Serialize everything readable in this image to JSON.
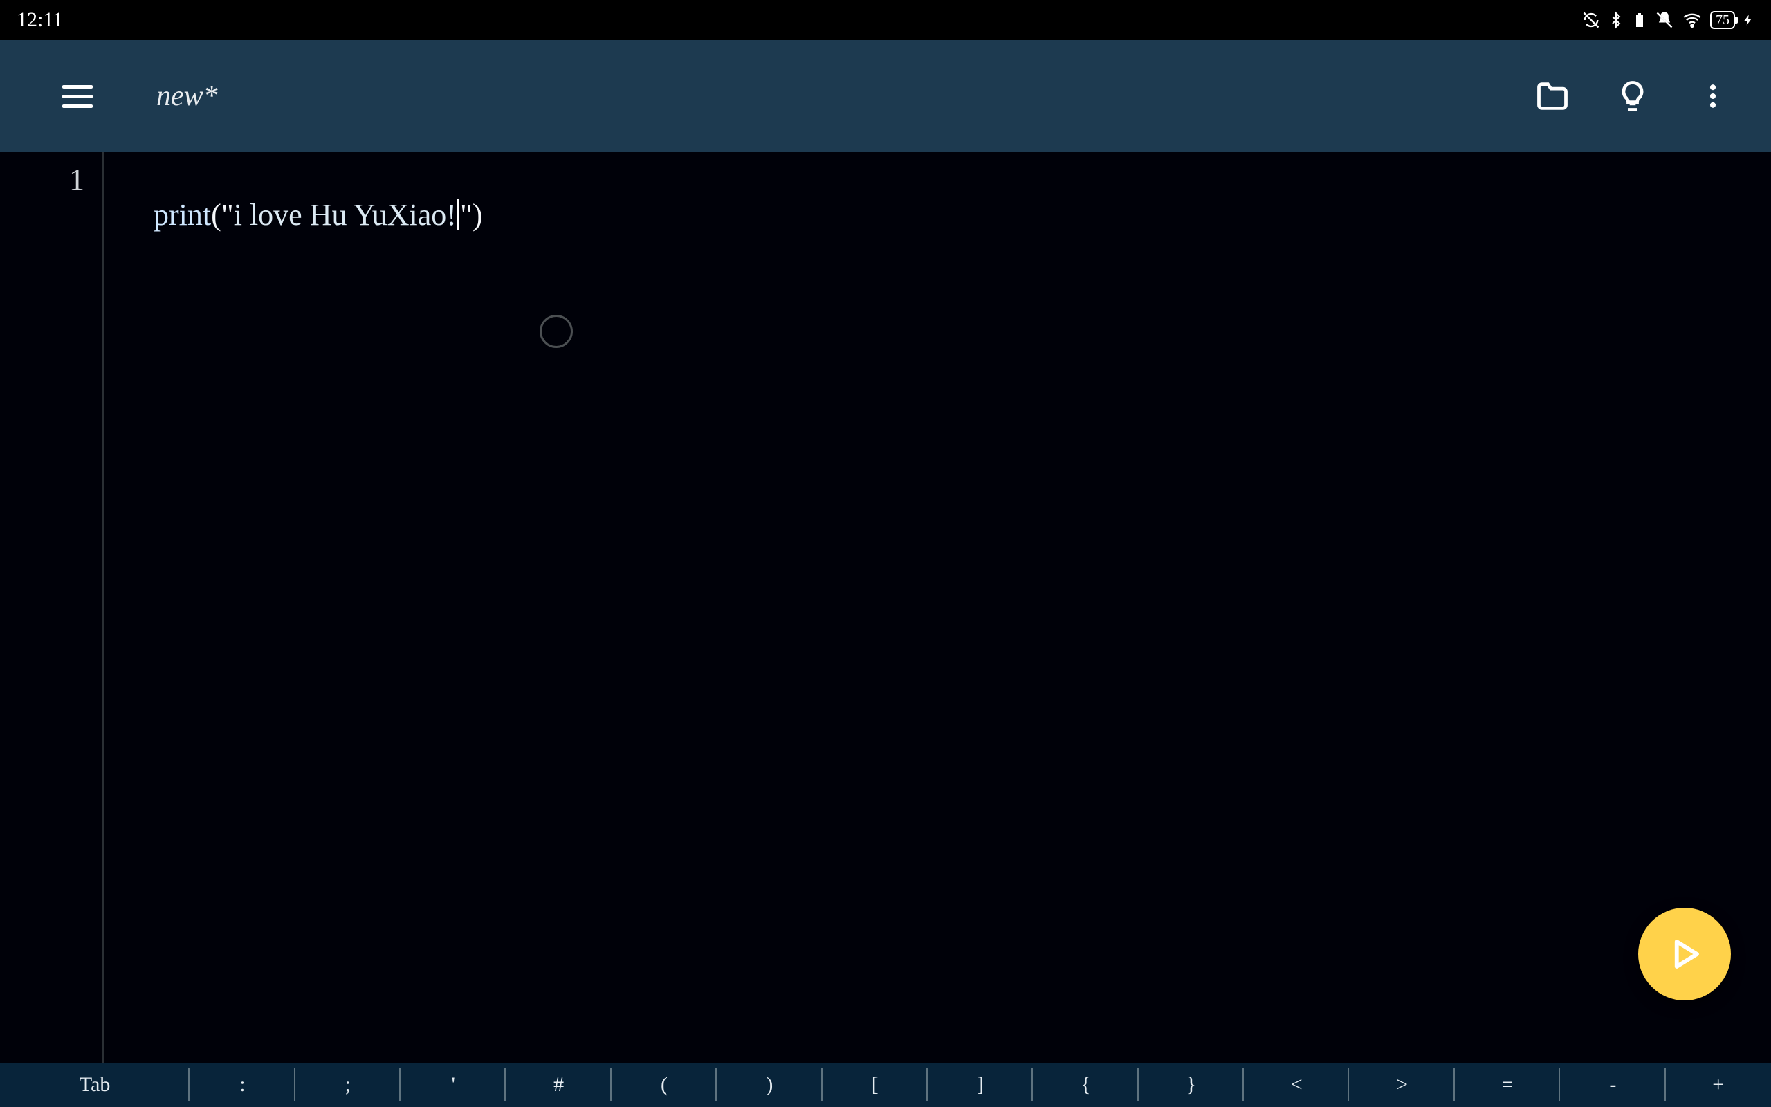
{
  "status": {
    "time": "12:11",
    "battery_text": "75"
  },
  "appbar": {
    "title": "new*"
  },
  "editor": {
    "lines": [
      {
        "num": "1",
        "fn": "print",
        "open": "(\"",
        "str": "i love Hu YuXiao!",
        "close": "\")"
      }
    ]
  },
  "keyrow": {
    "keys": [
      "Tab",
      ":",
      ";",
      "'",
      "#",
      "(",
      ")",
      "[",
      "]",
      "{",
      "}",
      "<",
      ">",
      "=",
      "-",
      "+"
    ]
  },
  "icons": {
    "folder": "folder-icon",
    "bulb": "bulb-icon",
    "more": "more-vert-icon",
    "menu": "hamburger-icon",
    "play": "play-icon"
  }
}
